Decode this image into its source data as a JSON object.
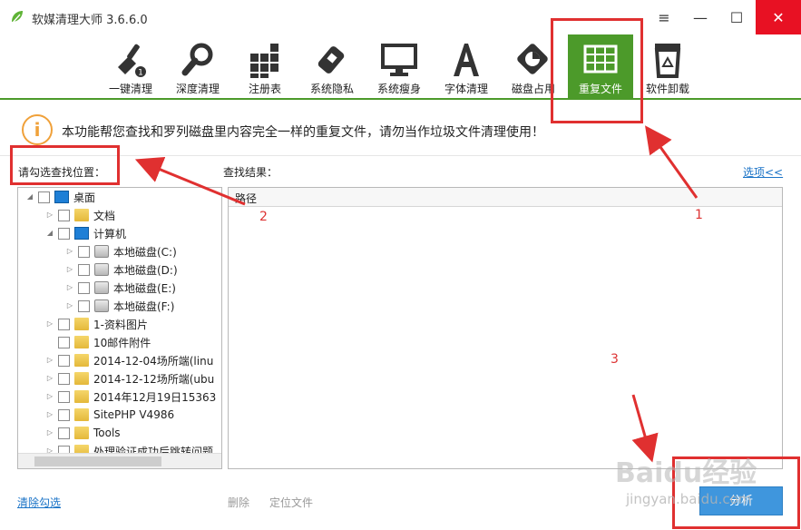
{
  "window": {
    "title": "软媒清理大师 3.6.6.0",
    "menu_glyph": "≡",
    "min_glyph": "—",
    "max_glyph": "☐",
    "close_glyph": "✕"
  },
  "toolbar": {
    "items": [
      {
        "label": "一键清理",
        "icon": "broom-icon"
      },
      {
        "label": "深度清理",
        "icon": "magnifier-icon"
      },
      {
        "label": "注册表",
        "icon": "registry-blocks-icon"
      },
      {
        "label": "系统隐私",
        "icon": "eraser-icon"
      },
      {
        "label": "系统瘦身",
        "icon": "monitor-icon"
      },
      {
        "label": "字体清理",
        "icon": "font-a-icon"
      },
      {
        "label": "磁盘占用",
        "icon": "disk-pie-icon"
      },
      {
        "label": "重复文件",
        "icon": "duplicate-grid-icon",
        "active": true
      },
      {
        "label": "软件卸载",
        "icon": "recycle-bin-icon"
      }
    ],
    "accent": "#4c9a2a"
  },
  "info": {
    "icon_glyph": "i",
    "text": "本功能帮您查找和罗列磁盘里内容完全一样的重复文件，请勿当作垃圾文件清理使用！"
  },
  "left_panel": {
    "label": "请勾选查找位置：",
    "tree": [
      {
        "text": "桌面",
        "type": "desktop"
      },
      {
        "text": "文档",
        "type": "folder"
      },
      {
        "text": "计算机",
        "type": "computer"
      },
      {
        "text": "本地磁盘(C:)",
        "type": "drive"
      },
      {
        "text": "本地磁盘(D:)",
        "type": "drive"
      },
      {
        "text": "本地磁盘(E:)",
        "type": "drive"
      },
      {
        "text": "本地磁盘(F:)",
        "type": "drive"
      },
      {
        "text": "1-资料图片",
        "type": "folder"
      },
      {
        "text": "10邮件附件",
        "type": "folder"
      },
      {
        "text": "2014-12-04场所端(linu",
        "type": "folder"
      },
      {
        "text": "2014-12-12场所端(ubu",
        "type": "folder"
      },
      {
        "text": "2014年12月19日15363",
        "type": "folder"
      },
      {
        "text": "SitePHP V4986",
        "type": "folder"
      },
      {
        "text": "Tools",
        "type": "folder"
      },
      {
        "text": "处理验证成功后跳转问题",
        "type": "folder"
      }
    ],
    "clear_link": "清除勾选"
  },
  "right_panel": {
    "label": "查找结果：",
    "options_link": "选项<<",
    "column_header": "路径",
    "delete_label": "删除",
    "locate_label": "定位文件",
    "analyze_label": "分析"
  },
  "annotations": {
    "num1": "1",
    "num2": "2",
    "num3": "3"
  },
  "watermark": {
    "main": "Baidu经验",
    "sub": "jingyan.baidu.com"
  }
}
